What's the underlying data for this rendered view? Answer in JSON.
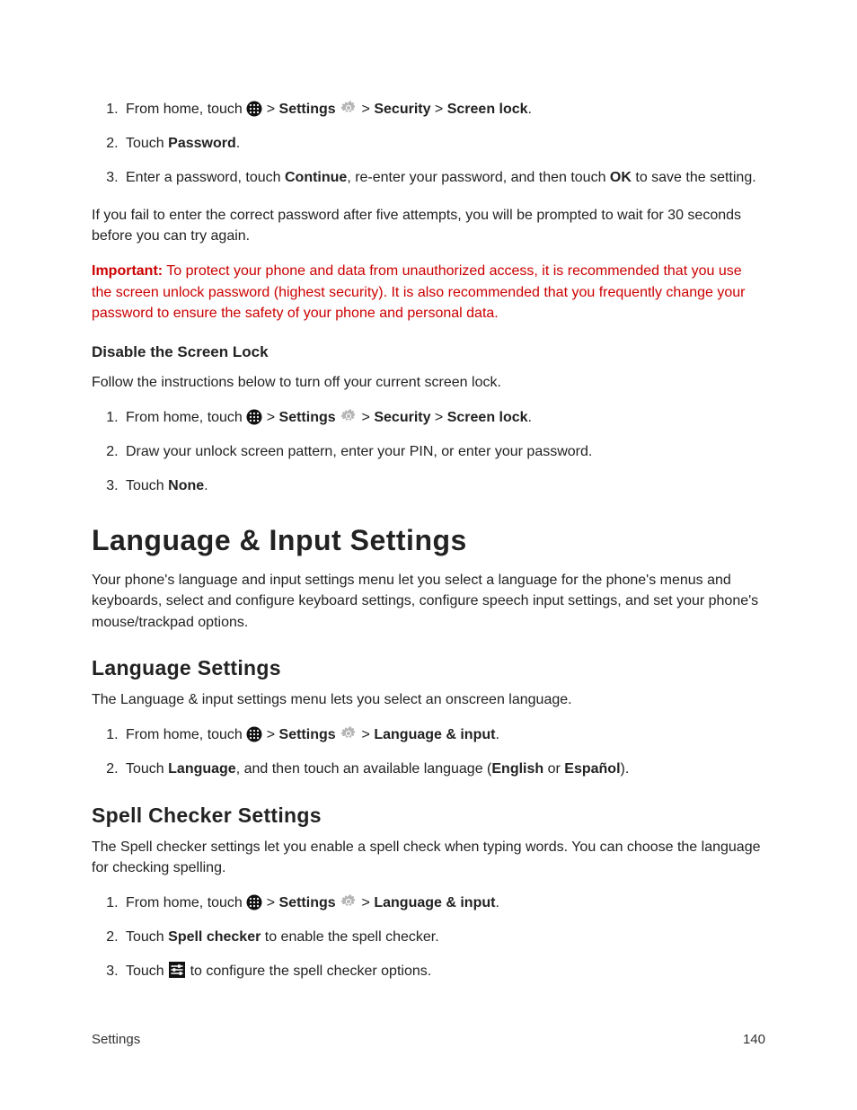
{
  "ol1": {
    "i1a": "From home, touch ",
    "i1b": " > ",
    "i1_settings": "Settings",
    "i1c": " > ",
    "i1_security": "Security",
    "i1d": " > ",
    "i1_screenlock": "Screen lock",
    "i1e": ".",
    "i2a": "Touch ",
    "i2_password": "Password",
    "i2b": ".",
    "i3a": "Enter a password, touch ",
    "i3_continue": "Continue",
    "i3b": ", re-enter your password, and then touch ",
    "i3_ok": "OK",
    "i3c": " to save the setting."
  },
  "para_fail": "If you fail to enter the correct password after five attempts, you will be prompted to wait for 30 seconds before you can try again.",
  "important": {
    "lead": "Important:",
    "text": " To protect your phone and data from unauthorized access, it is recommended that you use the screen unlock password (highest security). It is also recommended that you frequently change your password to ensure the safety of your phone and personal data."
  },
  "disable": {
    "heading": "Disable the Screen Lock",
    "intro": "Follow the instructions below to turn off your current screen lock.",
    "ol": {
      "i1a": "From home, touch ",
      "i1b": " > ",
      "i1_settings": "Settings",
      "i1c": " > ",
      "i1_security": "Security",
      "i1d": " > ",
      "i1_screenlock": "Screen lock",
      "i1e": ".",
      "i2": "Draw your unlock screen pattern, enter your PIN, or enter your password.",
      "i3a": "Touch ",
      "i3_none": "None",
      "i3b": "."
    }
  },
  "lang_input": {
    "h1": "Language & Input Settings",
    "intro": "Your phone's language and input settings menu let you select a language for the phone's menus and keyboards, select and configure keyboard settings, configure speech input settings, and set your phone's mouse/trackpad options."
  },
  "lang_settings": {
    "h2": "Language Settings",
    "intro": "The Language & input settings menu lets you select an onscreen language.",
    "ol": {
      "i1a": "From home, touch ",
      "i1b": " > ",
      "i1_settings": "Settings",
      "i1c": " > ",
      "i1_li": "Language & input",
      "i1d": ".",
      "i2a": "Touch ",
      "i2_lang": "Language",
      "i2b": ", and then touch an available language (",
      "i2_en": "English",
      "i2c": " or ",
      "i2_es": "Español",
      "i2d": ")."
    }
  },
  "spell": {
    "h2": "Spell Checker Settings",
    "intro": "The Spell checker settings let you enable a spell check when typing words. You can choose the language for checking spelling.",
    "ol": {
      "i1a": "From home, touch ",
      "i1b": " > ",
      "i1_settings": "Settings",
      "i1c": " > ",
      "i1_li": "Language & input",
      "i1d": ".",
      "i2a": "Touch ",
      "i2_sc": "Spell checker",
      "i2b": " to enable the spell checker.",
      "i3a": "Touch ",
      "i3b": " to configure the spell checker options."
    }
  },
  "footer": {
    "left": "Settings",
    "right": "140"
  }
}
